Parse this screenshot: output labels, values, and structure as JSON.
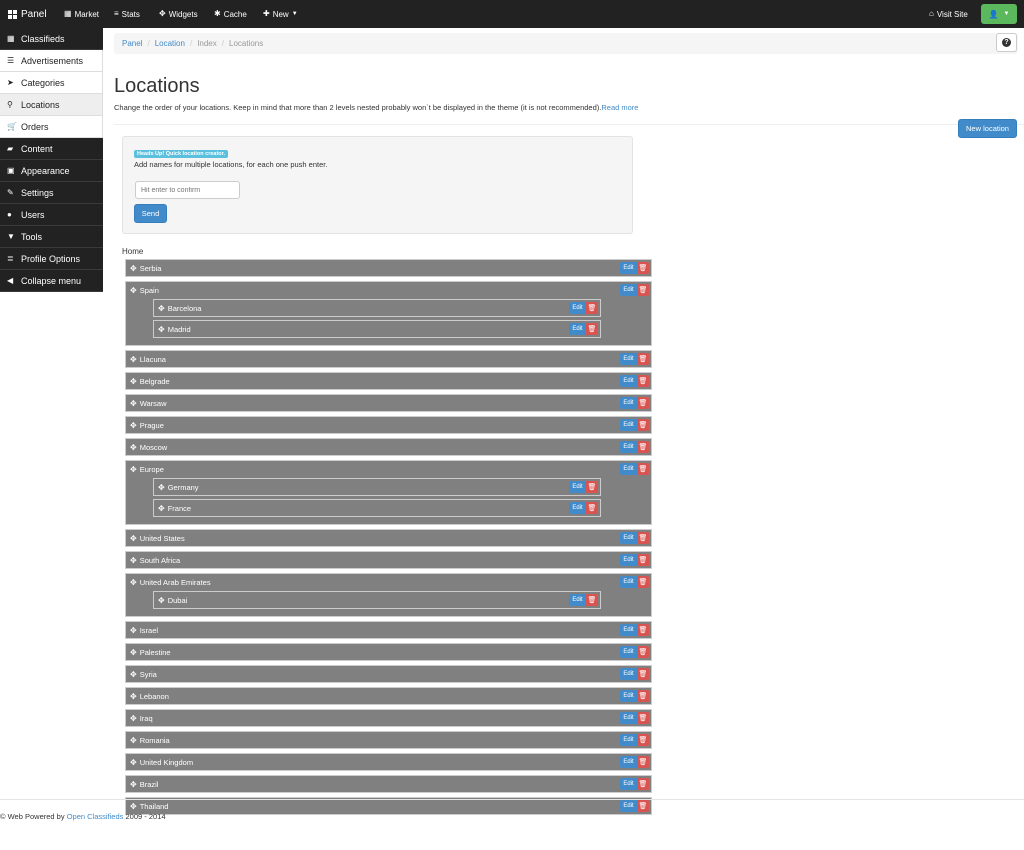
{
  "topnav": {
    "brand": "Panel",
    "market": "Market",
    "stats": "Stats",
    "widgets": "Widgets",
    "cache": "Cache",
    "new": "New",
    "visit_site": "Visit Site"
  },
  "sidebar": {
    "items": [
      {
        "label": "Classifieds",
        "icon": "th-icon"
      },
      {
        "label": "Advertisements",
        "icon": "list-icon"
      },
      {
        "label": "Categories",
        "icon": "tags-icon"
      },
      {
        "label": "Locations",
        "icon": "map-marker-icon"
      },
      {
        "label": "Orders",
        "icon": "shopping-cart-icon"
      },
      {
        "label": "Content",
        "icon": "folder-open-icon"
      },
      {
        "label": "Appearance",
        "icon": "picture-icon"
      },
      {
        "label": "Settings",
        "icon": "wrench-icon"
      },
      {
        "label": "Users",
        "icon": "user-icon"
      },
      {
        "label": "Tools",
        "icon": "filter-icon"
      },
      {
        "label": "Profile Options",
        "icon": "list-alt-icon"
      },
      {
        "label": "Collapse menu",
        "icon": "circle-arrow-left-icon"
      }
    ]
  },
  "breadcrumb": {
    "panel": "Panel",
    "location": "Location",
    "index": "Index",
    "locations": "Locations"
  },
  "help": "?",
  "page": {
    "title": "Locations",
    "description": "Change the order of your locations. Keep in mind that more than 2 levels nested probably won`t be displayed in the theme (it is not recommended).",
    "read_more": "Read more",
    "new_location": "New location"
  },
  "quick": {
    "badge": "Heads Up! Quick location creator.",
    "hint": "Add names for multiple locations, for each one push enter.",
    "placeholder": "Hit enter to confirm",
    "send": "Send"
  },
  "tree": {
    "root": "Home",
    "edit": "Edit",
    "locations": [
      {
        "name": "Serbia",
        "children": []
      },
      {
        "name": "Spain",
        "children": [
          "Barcelona",
          "Madrid"
        ]
      },
      {
        "name": "Llacuna",
        "children": []
      },
      {
        "name": "Belgrade",
        "children": []
      },
      {
        "name": "Warsaw",
        "children": []
      },
      {
        "name": "Prague",
        "children": []
      },
      {
        "name": "Moscow",
        "children": []
      },
      {
        "name": "Europe",
        "children": [
          "Germany",
          "France"
        ]
      },
      {
        "name": "United States",
        "children": []
      },
      {
        "name": "South Africa",
        "children": []
      },
      {
        "name": "United Arab Emirates",
        "children": [
          "Dubai"
        ]
      },
      {
        "name": "Israel",
        "children": []
      },
      {
        "name": "Palestine",
        "children": []
      },
      {
        "name": "Syria",
        "children": []
      },
      {
        "name": "Lebanon",
        "children": []
      },
      {
        "name": "Iraq",
        "children": []
      },
      {
        "name": "Romania",
        "children": []
      },
      {
        "name": "United Kingdom",
        "children": []
      },
      {
        "name": "Brazil",
        "children": []
      },
      {
        "name": "Thailand",
        "children": []
      }
    ]
  },
  "footer": {
    "prefix": "© Web Powered by",
    "link": "Open Classifieds",
    "years": "2009 - 2014"
  },
  "colors": {
    "topbar": "#222222",
    "primary": "#428bca",
    "danger": "#d9534f",
    "success": "#5cb85c",
    "info": "#5bc0de",
    "row": "#808080"
  }
}
